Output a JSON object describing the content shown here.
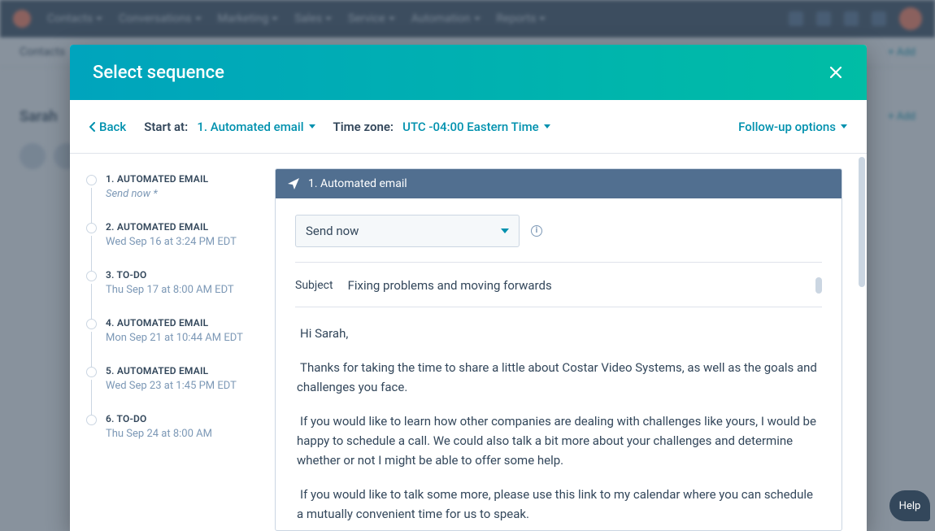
{
  "topnav": {
    "items": [
      "Contacts",
      "Conversations",
      "Marketing",
      "Sales",
      "Service",
      "Automation",
      "Reports"
    ]
  },
  "modal": {
    "title": "Select sequence",
    "back": "Back",
    "start_at_label": "Start at:",
    "start_at_value": "1. Automated email",
    "tz_label": "Time zone:",
    "tz_value": "UTC -04:00 Eastern Time",
    "followup": "Follow-up options"
  },
  "steps": [
    {
      "title": "1. AUTOMATED EMAIL",
      "meta": "Send now *",
      "italic": true
    },
    {
      "title": "2. AUTOMATED EMAIL",
      "meta": "Wed Sep 16 at 3:24 PM EDT"
    },
    {
      "title": "3. TO-DO",
      "meta": "Thu Sep 17 at 8:00 AM EDT"
    },
    {
      "title": "4. AUTOMATED EMAIL",
      "meta": "Mon Sep 21 at 10:44 AM EDT"
    },
    {
      "title": "5. AUTOMATED EMAIL",
      "meta": "Wed Sep 23 at 1:45 PM EDT"
    },
    {
      "title": "6. TO-DO",
      "meta": "Thu Sep 24 at 8:00 AM"
    }
  ],
  "editor": {
    "header": "1. Automated email",
    "send_mode": "Send now",
    "subject_label": "Subject",
    "subject_value": "Fixing problems and moving forwards",
    "body": {
      "greeting": "Hi Sarah,",
      "p1": "Thanks for taking the time to share a little about Costar Video Systems, as well as the goals and challenges you face.",
      "p2": "If you would like to learn how other companies are dealing with challenges like yours, I would be happy to schedule a call. We could also talk a bit more about your challenges and determine whether or not I might be able to offer some help.",
      "p3": "If you would like to talk some more, please use this link to my calendar where you can schedule a mutually convenient time for us to speak."
    }
  },
  "help": "Help"
}
